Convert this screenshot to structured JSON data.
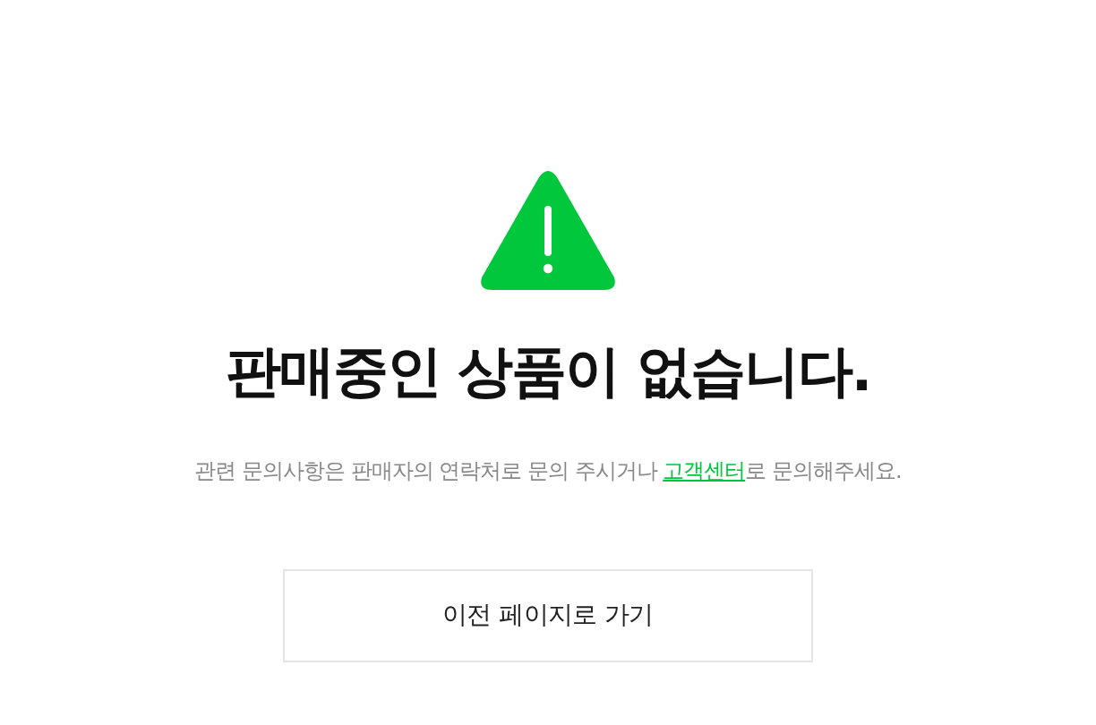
{
  "title": "판매중인 상품이 없습니다.",
  "description": {
    "before": "관련 문의사항은 판매자의 연락처로 문의 주시거나 ",
    "link": "고객센터",
    "after": "로 문의해주세요."
  },
  "button": "이전 페이지로 가기"
}
